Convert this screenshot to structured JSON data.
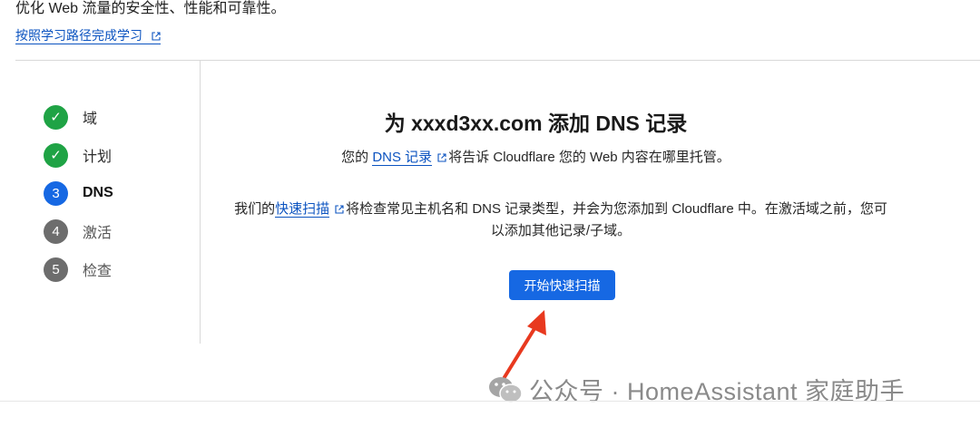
{
  "header": {
    "description": "优化 Web 流量的安全性、性能和可靠性。",
    "learn_link": "按照学习路径完成学习"
  },
  "steps": [
    {
      "label": "域",
      "marker": "✓",
      "state": "done"
    },
    {
      "label": "计划",
      "marker": "✓",
      "state": "done"
    },
    {
      "label": "DNS",
      "marker": "3",
      "state": "active"
    },
    {
      "label": "激活",
      "marker": "4",
      "state": "pending"
    },
    {
      "label": "检查",
      "marker": "5",
      "state": "pending"
    }
  ],
  "main": {
    "title": "为 xxxd3xx.com 添加 DNS 记录",
    "desc1_before": "您的 ",
    "desc1_link": "DNS 记录",
    "desc1_after": "将告诉 Cloudflare 您的 Web 内容在哪里托管。",
    "desc2_before": "我们的",
    "desc2_link": "快速扫描",
    "desc2_after": "将检查常见主机名和 DNS 记录类型，并会为您添加到 Cloudflare 中。在激活域之前，您可以添加其他记录/子域。",
    "scan_button": "开始快速扫描"
  },
  "watermark": {
    "text": "公众号 · HomeAssistant 家庭助手",
    "icon": "wechat-icon"
  },
  "colors": {
    "accent": "#1668e3",
    "link": "#0b53c0",
    "done": "#1fa345",
    "pending": "#6d6d6d",
    "arrow": "#e8391f"
  }
}
